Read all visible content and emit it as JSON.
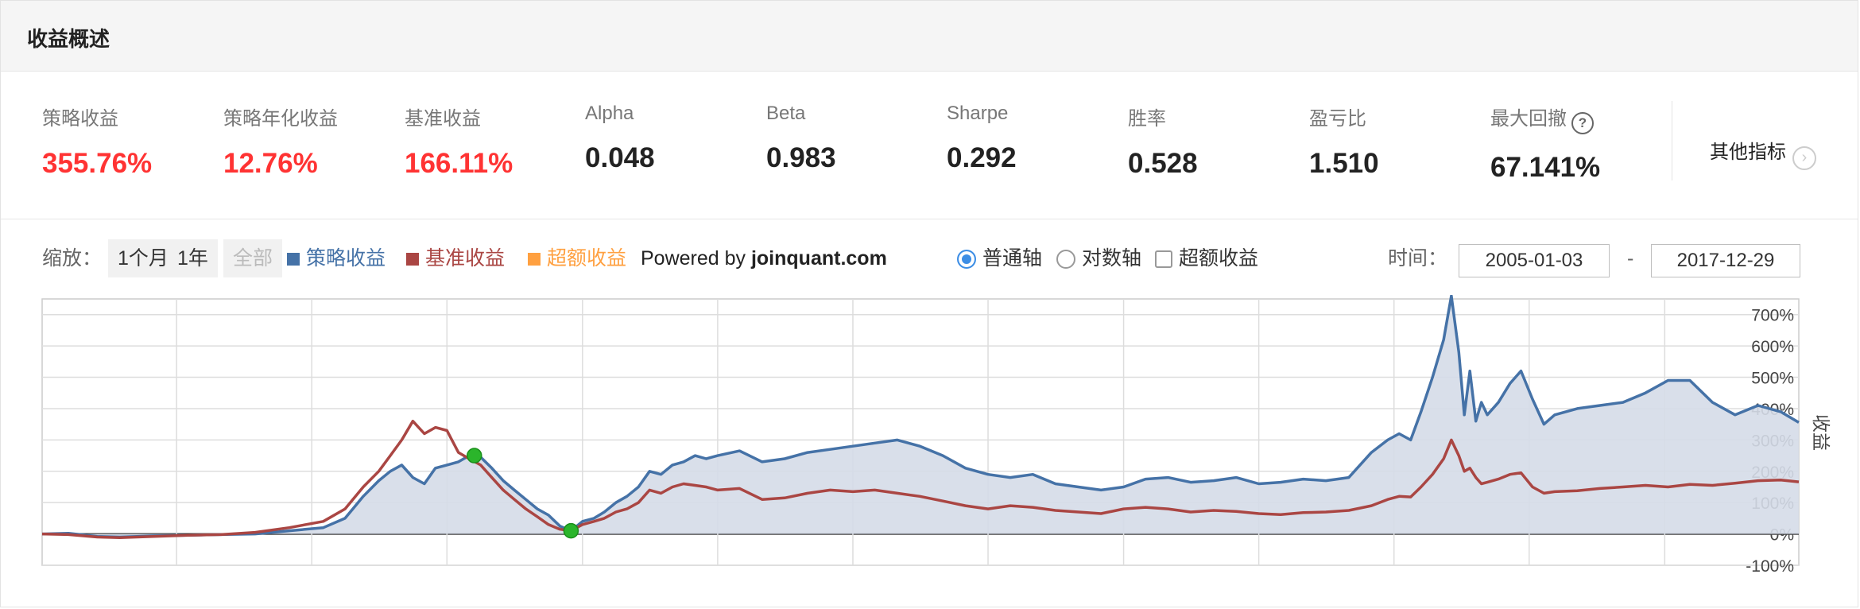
{
  "header": {
    "title": "收益概述"
  },
  "metrics": [
    {
      "label": "策略收益",
      "value": "355.76%",
      "red": true
    },
    {
      "label": "策略年化收益",
      "value": "12.76%",
      "red": true
    },
    {
      "label": "基准收益",
      "value": "166.11%",
      "red": true
    },
    {
      "label": "Alpha",
      "value": "0.048",
      "red": false
    },
    {
      "label": "Beta",
      "value": "0.983",
      "red": false
    },
    {
      "label": "Sharpe",
      "value": "0.292",
      "red": false
    },
    {
      "label": "胜率",
      "value": "0.528",
      "red": false
    },
    {
      "label": "盈亏比",
      "value": "1.510",
      "red": false
    },
    {
      "label": "最大回撤",
      "value": "67.141%",
      "red": false,
      "help_icon": "question-mark-icon"
    }
  ],
  "other_indicators": {
    "label": "其他指标",
    "icon": "chevron-right-icon"
  },
  "toolbar": {
    "zoom_label": "缩放：",
    "zoom_buttons": [
      {
        "label": "1个月",
        "disabled": false
      },
      {
        "label": "1年",
        "disabled": false
      },
      {
        "label": "全部",
        "disabled": true
      }
    ],
    "legend": [
      {
        "label": "策略收益",
        "color": "#4572a7"
      },
      {
        "label": "基准收益",
        "color": "#aa4643"
      },
      {
        "label": "超额收益",
        "color": "#ffa040"
      }
    ],
    "powered_prefix": "Powered by ",
    "powered_site": "joinquant.com",
    "axis_options": [
      {
        "label": "普通轴",
        "type": "radio",
        "checked": true
      },
      {
        "label": "对数轴",
        "type": "radio",
        "checked": false
      },
      {
        "label": "超额收益",
        "type": "checkbox",
        "checked": false
      }
    ],
    "time_label": "时间：",
    "start_date": "2005-01-03",
    "date_separator": "-",
    "end_date": "2017-12-29"
  },
  "chart_data": {
    "type": "area",
    "ylabel": "收益",
    "ylim": [
      -100,
      750
    ],
    "yticks": [
      "700%",
      "600%",
      "500%",
      "400%",
      "300%",
      "200%",
      "100%",
      "0%",
      "-100%"
    ],
    "ytick_values": [
      700,
      600,
      500,
      400,
      300,
      200,
      100,
      0,
      -100
    ],
    "xlim": [
      "2005-01-03",
      "2017-12-29"
    ],
    "grid": true,
    "series": [
      {
        "name": "策略收益",
        "color": "#4572a7",
        "fill": "#d5dce8",
        "points": [
          [
            "2005-01-03",
            0
          ],
          [
            "2005-03-15",
            2
          ],
          [
            "2005-06-01",
            -8
          ],
          [
            "2005-08-01",
            -10
          ],
          [
            "2005-11-01",
            -6
          ],
          [
            "2006-02-01",
            -4
          ],
          [
            "2006-05-01",
            -2
          ],
          [
            "2006-08-01",
            0
          ],
          [
            "2006-11-01",
            10
          ],
          [
            "2007-02-01",
            20
          ],
          [
            "2007-04-01",
            50
          ],
          [
            "2007-05-20",
            120
          ],
          [
            "2007-07-01",
            170
          ],
          [
            "2007-08-01",
            200
          ],
          [
            "2007-09-01",
            220
          ],
          [
            "2007-10-01",
            180
          ],
          [
            "2007-11-01",
            160
          ],
          [
            "2007-12-01",
            210
          ],
          [
            "2008-01-01",
            220
          ],
          [
            "2008-02-01",
            230
          ],
          [
            "2008-03-01",
            250
          ],
          [
            "2008-04-01",
            245
          ],
          [
            "2008-05-01",
            210
          ],
          [
            "2008-06-01",
            170
          ],
          [
            "2008-07-01",
            140
          ],
          [
            "2008-08-01",
            110
          ],
          [
            "2008-09-01",
            80
          ],
          [
            "2008-10-01",
            60
          ],
          [
            "2008-11-01",
            25
          ],
          [
            "2008-12-01",
            10
          ],
          [
            "2009-01-01",
            40
          ],
          [
            "2009-02-01",
            50
          ],
          [
            "2009-03-01",
            70
          ],
          [
            "2009-04-01",
            100
          ],
          [
            "2009-05-01",
            120
          ],
          [
            "2009-06-01",
            150
          ],
          [
            "2009-07-01",
            200
          ],
          [
            "2009-08-01",
            190
          ],
          [
            "2009-09-01",
            220
          ],
          [
            "2009-10-01",
            230
          ],
          [
            "2009-11-01",
            250
          ],
          [
            "2009-12-01",
            240
          ],
          [
            "2010-01-01",
            250
          ],
          [
            "2010-03-01",
            265
          ],
          [
            "2010-05-01",
            230
          ],
          [
            "2010-07-01",
            240
          ],
          [
            "2010-09-01",
            260
          ],
          [
            "2010-11-01",
            270
          ],
          [
            "2011-01-01",
            280
          ],
          [
            "2011-03-01",
            290
          ],
          [
            "2011-05-01",
            300
          ],
          [
            "2011-07-01",
            280
          ],
          [
            "2011-09-01",
            250
          ],
          [
            "2011-11-01",
            210
          ],
          [
            "2012-01-01",
            190
          ],
          [
            "2012-03-01",
            180
          ],
          [
            "2012-05-01",
            190
          ],
          [
            "2012-07-01",
            160
          ],
          [
            "2012-09-01",
            150
          ],
          [
            "2012-11-01",
            140
          ],
          [
            "2013-01-01",
            150
          ],
          [
            "2013-03-01",
            175
          ],
          [
            "2013-05-01",
            180
          ],
          [
            "2013-07-01",
            165
          ],
          [
            "2013-09-01",
            170
          ],
          [
            "2013-11-01",
            180
          ],
          [
            "2014-01-01",
            160
          ],
          [
            "2014-03-01",
            165
          ],
          [
            "2014-05-01",
            175
          ],
          [
            "2014-07-01",
            170
          ],
          [
            "2014-09-01",
            180
          ],
          [
            "2014-11-01",
            260
          ],
          [
            "2014-12-15",
            300
          ],
          [
            "2015-01-15",
            320
          ],
          [
            "2015-02-15",
            300
          ],
          [
            "2015-03-15",
            390
          ],
          [
            "2015-04-15",
            500
          ],
          [
            "2015-05-15",
            620
          ],
          [
            "2015-06-05",
            760
          ],
          [
            "2015-06-25",
            580
          ],
          [
            "2015-07-10",
            380
          ],
          [
            "2015-07-25",
            520
          ],
          [
            "2015-08-10",
            360
          ],
          [
            "2015-08-25",
            420
          ],
          [
            "2015-09-10",
            380
          ],
          [
            "2015-10-10",
            420
          ],
          [
            "2015-11-10",
            480
          ],
          [
            "2015-12-10",
            520
          ],
          [
            "2016-01-10",
            430
          ],
          [
            "2016-02-10",
            350
          ],
          [
            "2016-03-10",
            380
          ],
          [
            "2016-05-10",
            400
          ],
          [
            "2016-07-10",
            410
          ],
          [
            "2016-09-10",
            420
          ],
          [
            "2016-11-10",
            450
          ],
          [
            "2017-01-10",
            490
          ],
          [
            "2017-03-10",
            490
          ],
          [
            "2017-05-10",
            420
          ],
          [
            "2017-07-10",
            380
          ],
          [
            "2017-09-10",
            410
          ],
          [
            "2017-11-10",
            390
          ],
          [
            "2017-12-29",
            355.76
          ]
        ]
      },
      {
        "name": "基准收益",
        "color": "#aa4643",
        "points": [
          [
            "2005-01-03",
            0
          ],
          [
            "2005-03-15",
            -2
          ],
          [
            "2005-06-01",
            -10
          ],
          [
            "2005-08-01",
            -12
          ],
          [
            "2005-11-01",
            -8
          ],
          [
            "2006-02-01",
            -4
          ],
          [
            "2006-05-01",
            -2
          ],
          [
            "2006-08-01",
            5
          ],
          [
            "2006-11-01",
            20
          ],
          [
            "2007-02-01",
            40
          ],
          [
            "2007-04-01",
            80
          ],
          [
            "2007-05-20",
            150
          ],
          [
            "2007-07-01",
            200
          ],
          [
            "2007-08-01",
            250
          ],
          [
            "2007-09-01",
            300
          ],
          [
            "2007-10-01",
            360
          ],
          [
            "2007-11-01",
            320
          ],
          [
            "2007-12-01",
            340
          ],
          [
            "2008-01-01",
            330
          ],
          [
            "2008-02-01",
            260
          ],
          [
            "2008-03-01",
            240
          ],
          [
            "2008-04-01",
            220
          ],
          [
            "2008-05-01",
            180
          ],
          [
            "2008-06-01",
            140
          ],
          [
            "2008-07-01",
            110
          ],
          [
            "2008-08-01",
            80
          ],
          [
            "2008-09-01",
            55
          ],
          [
            "2008-10-01",
            30
          ],
          [
            "2008-11-01",
            15
          ],
          [
            "2008-12-01",
            10
          ],
          [
            "2009-01-01",
            30
          ],
          [
            "2009-02-01",
            40
          ],
          [
            "2009-03-01",
            50
          ],
          [
            "2009-04-01",
            70
          ],
          [
            "2009-05-01",
            80
          ],
          [
            "2009-06-01",
            100
          ],
          [
            "2009-07-01",
            140
          ],
          [
            "2009-08-01",
            130
          ],
          [
            "2009-09-01",
            150
          ],
          [
            "2009-10-01",
            160
          ],
          [
            "2009-11-01",
            155
          ],
          [
            "2009-12-01",
            150
          ],
          [
            "2010-01-01",
            140
          ],
          [
            "2010-03-01",
            145
          ],
          [
            "2010-05-01",
            110
          ],
          [
            "2010-07-01",
            115
          ],
          [
            "2010-09-01",
            130
          ],
          [
            "2010-11-01",
            140
          ],
          [
            "2011-01-01",
            135
          ],
          [
            "2011-03-01",
            140
          ],
          [
            "2011-05-01",
            130
          ],
          [
            "2011-07-01",
            120
          ],
          [
            "2011-09-01",
            105
          ],
          [
            "2011-11-01",
            90
          ],
          [
            "2012-01-01",
            80
          ],
          [
            "2012-03-01",
            90
          ],
          [
            "2012-05-01",
            85
          ],
          [
            "2012-07-01",
            75
          ],
          [
            "2012-09-01",
            70
          ],
          [
            "2012-11-01",
            65
          ],
          [
            "2013-01-01",
            80
          ],
          [
            "2013-03-01",
            85
          ],
          [
            "2013-05-01",
            80
          ],
          [
            "2013-07-01",
            70
          ],
          [
            "2013-09-01",
            75
          ],
          [
            "2013-11-01",
            72
          ],
          [
            "2014-01-01",
            65
          ],
          [
            "2014-03-01",
            62
          ],
          [
            "2014-05-01",
            68
          ],
          [
            "2014-07-01",
            70
          ],
          [
            "2014-09-01",
            75
          ],
          [
            "2014-11-01",
            90
          ],
          [
            "2014-12-15",
            110
          ],
          [
            "2015-01-15",
            120
          ],
          [
            "2015-02-15",
            118
          ],
          [
            "2015-03-15",
            150
          ],
          [
            "2015-04-15",
            190
          ],
          [
            "2015-05-15",
            240
          ],
          [
            "2015-06-05",
            300
          ],
          [
            "2015-06-25",
            250
          ],
          [
            "2015-07-10",
            200
          ],
          [
            "2015-07-25",
            210
          ],
          [
            "2015-08-10",
            180
          ],
          [
            "2015-08-25",
            160
          ],
          [
            "2015-09-10",
            165
          ],
          [
            "2015-10-10",
            175
          ],
          [
            "2015-11-10",
            190
          ],
          [
            "2015-12-10",
            195
          ],
          [
            "2016-01-10",
            150
          ],
          [
            "2016-02-10",
            130
          ],
          [
            "2016-03-10",
            135
          ],
          [
            "2016-05-10",
            138
          ],
          [
            "2016-07-10",
            145
          ],
          [
            "2016-09-10",
            150
          ],
          [
            "2016-11-10",
            155
          ],
          [
            "2017-01-10",
            150
          ],
          [
            "2017-03-10",
            158
          ],
          [
            "2017-05-10",
            155
          ],
          [
            "2017-07-10",
            162
          ],
          [
            "2017-09-10",
            170
          ],
          [
            "2017-11-10",
            172
          ],
          [
            "2017-12-29",
            166.11
          ]
        ]
      }
    ],
    "markers": [
      {
        "date": "2008-03-15",
        "value": 250,
        "color": "#2bb52b"
      },
      {
        "date": "2008-12-01",
        "value": 10,
        "color": "#2bb52b"
      }
    ]
  }
}
